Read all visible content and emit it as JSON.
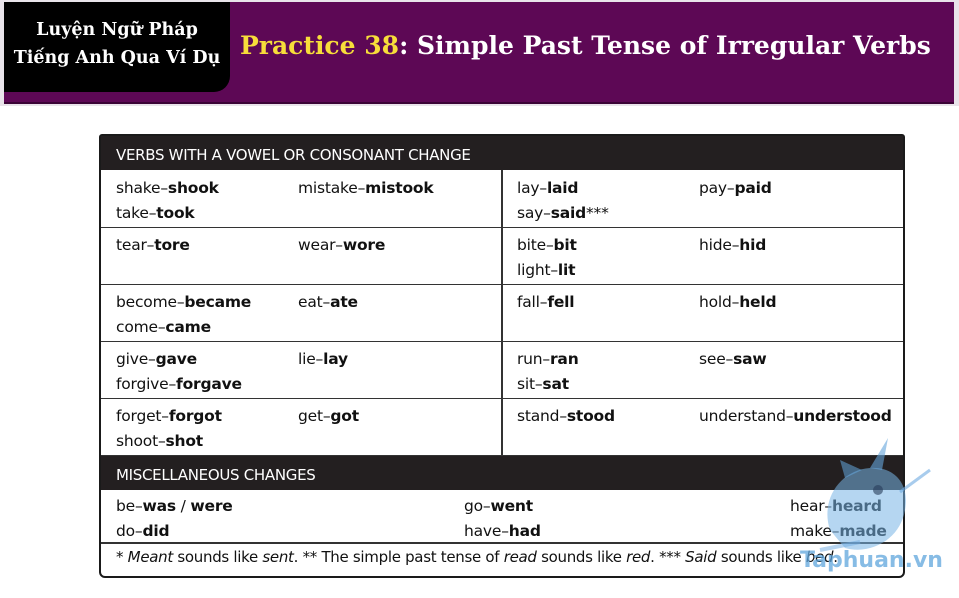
{
  "banner": {
    "badge_line1": "Luyện Ngữ Pháp",
    "badge_line2": "Tiếng Anh Qua Ví Dụ",
    "title_highlight": "Practice 38",
    "title_rest": ": Simple Past Tense of Irregular Verbs"
  },
  "section1": {
    "header": "VERBS WITH A VOWEL OR CONSONANT CHANGE",
    "rows": [
      [
        [
          [
            "shake–",
            "shook",
            ""
          ],
          [
            "take–",
            "took",
            ""
          ]
        ],
        [
          [
            "mistake–",
            "mistook",
            ""
          ]
        ],
        [
          [
            "lay–",
            "laid",
            ""
          ],
          [
            "say–",
            "said",
            "***"
          ]
        ],
        [
          [
            "pay–",
            "paid",
            ""
          ]
        ]
      ],
      [
        [
          [
            "tear–",
            "tore",
            ""
          ]
        ],
        [
          [
            "wear–",
            "wore",
            ""
          ]
        ],
        [
          [
            "bite–",
            "bit",
            ""
          ],
          [
            "light–",
            "lit",
            ""
          ]
        ],
        [
          [
            "hide–",
            "hid",
            ""
          ]
        ]
      ],
      [
        [
          [
            "become–",
            "became",
            ""
          ],
          [
            "come–",
            "came",
            ""
          ]
        ],
        [
          [
            "eat–",
            "ate",
            ""
          ]
        ],
        [
          [
            "fall–",
            "fell",
            ""
          ]
        ],
        [
          [
            "hold–",
            "held",
            ""
          ]
        ]
      ],
      [
        [
          [
            "give–",
            "gave",
            ""
          ],
          [
            "forgive–",
            "forgave",
            ""
          ]
        ],
        [
          [
            "lie–",
            "lay",
            ""
          ]
        ],
        [
          [
            "run–",
            "ran",
            ""
          ],
          [
            "sit–",
            "sat",
            ""
          ]
        ],
        [
          [
            "see–",
            "saw",
            ""
          ]
        ]
      ],
      [
        [
          [
            "forget–",
            "forgot",
            ""
          ],
          [
            "shoot–",
            "shot",
            ""
          ]
        ],
        [
          [
            "get–",
            "got",
            ""
          ]
        ],
        [
          [
            "stand–",
            "stood",
            ""
          ]
        ],
        [
          [
            "understand–",
            "understood",
            ""
          ]
        ]
      ]
    ]
  },
  "section2": {
    "header": "MISCELLANEOUS CHANGES",
    "cols": [
      [
        [
          "be–",
          "was",
          " / ",
          "were"
        ],
        [
          "do–",
          "did",
          "",
          ""
        ]
      ],
      [
        [
          "go–",
          "went",
          "",
          ""
        ],
        [
          "have–",
          "had",
          "",
          ""
        ]
      ],
      [
        [
          "hear–",
          "heard",
          "",
          ""
        ],
        [
          "make–",
          "made",
          "",
          ""
        ]
      ]
    ]
  },
  "footnote": {
    "p1": "* ",
    "p2": "Meant",
    "p3": " sounds like ",
    "p4": "sent",
    "p5": ".   ** The simple past tense of ",
    "p6": "read",
    "p7": " sounds like ",
    "p8": "red",
    "p9": ".   *** ",
    "p10": "Said",
    "p11": " sounds like ",
    "p12": "bed",
    "p13": "."
  },
  "watermark": {
    "text": "Taphuan.vn"
  }
}
